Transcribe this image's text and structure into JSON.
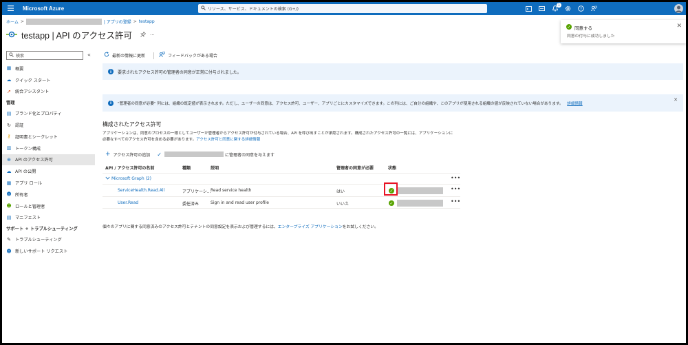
{
  "topbar": {
    "brand": "Microsoft Azure",
    "search_placeholder": "リソース、サービス、ドキュメントの検索 (G+/)",
    "notification_count": "1"
  },
  "breadcrumb": {
    "home": "ホーム",
    "sep": ">",
    "app_registrations": "| アプリの登録",
    "app": "testapp"
  },
  "page": {
    "title": "testapp | API のアクセス許可"
  },
  "sidebar": {
    "search_placeholder": "検索",
    "collapse": "«",
    "items_top": [
      {
        "label": "概要",
        "icon": "overview-icon",
        "glyph": "▦",
        "color": "#0f6cbd"
      },
      {
        "label": "クイック スタート",
        "icon": "quickstart-icon",
        "glyph": "☁",
        "color": "#0f6cbd"
      },
      {
        "label": "統合アシスタント",
        "icon": "rocket-icon",
        "glyph": "➚",
        "color": "#d83b01"
      }
    ],
    "manage_header": "管理",
    "items_manage": [
      {
        "label": "ブランド化とプロパティ",
        "icon": "branding-icon",
        "glyph": "▤",
        "color": "#0f6cbd"
      },
      {
        "label": "認証",
        "icon": "auth-icon",
        "glyph": "↻",
        "color": "#323130"
      },
      {
        "label": "証明書とシークレット",
        "icon": "key-icon",
        "glyph": "⚷",
        "color": "#e8a202"
      },
      {
        "label": "トークン構成",
        "icon": "token-icon",
        "glyph": "▥",
        "color": "#0f6cbd"
      },
      {
        "label": "API のアクセス許可",
        "icon": "api-permissions-icon",
        "glyph": "⊕",
        "color": "#0f6cbd",
        "active": true
      },
      {
        "label": "API の公開",
        "icon": "cloud-icon",
        "glyph": "☁",
        "color": "#0f6cbd"
      },
      {
        "label": "アプリ ロール",
        "icon": "app-roles-icon",
        "glyph": "▦",
        "color": "#0f6cbd"
      },
      {
        "label": "所有者",
        "icon": "owners-icon",
        "glyph": "☻",
        "color": "#0f6cbd"
      },
      {
        "label": "ロールと管理者",
        "icon": "roles-icon",
        "glyph": "☻",
        "color": "#57a300"
      },
      {
        "label": "マニフェスト",
        "icon": "manifest-icon",
        "glyph": "▤",
        "color": "#0f6cbd"
      }
    ],
    "support_header": "サポート + トラブルシューティング",
    "items_support": [
      {
        "label": "トラブルシューティング",
        "icon": "wrench-icon",
        "glyph": "✎",
        "color": "#323130"
      },
      {
        "label": "新しいサポート リクエスト",
        "icon": "support-icon",
        "glyph": "☻",
        "color": "#0f6cbd"
      }
    ]
  },
  "toolbar": {
    "refresh": "最新の情報に更新",
    "feedback": "フィードバックがある場合"
  },
  "banners": {
    "consent_success": "要求されたアクセス許可の管理者の同意が正常に付与されました。",
    "info": "\"管理者の同意が必要\" 列には、組織の既定値が表示されます。ただし、ユーザーの同意は、アクセス許可、ユーザー、アプリごとにカスタマイズできます。この列には、ご自分の組織や、このアプリが使用される組織の値が反映されていない場合があります。",
    "info_link": "詳細情報"
  },
  "configured": {
    "title": "構成されたアクセス許可",
    "desc_1": "アプリケーションは、同意のプロセスの一環としてユーザーか管理者からアクセス許可が付与されている場合、API を呼び出すことが承認されます。構成されたアクセス許可の一覧には、アプリケーションに",
    "desc_2": "必要なすべてのアクセス許可を含める必要があります。",
    "desc_link": "アクセス許可と同意に関する詳細情報",
    "add_permission": "アクセス許可の追加",
    "grant_consent_suffix": "に管理者の同意を与えます"
  },
  "table": {
    "headers": {
      "api": "API / アクセス許可の名前",
      "type": "種類",
      "desc": "説明",
      "admin": "管理者の同意が必要",
      "status": "状態"
    },
    "group": "Microsoft Graph (2)",
    "more": "•••",
    "rows": [
      {
        "name": "ServiceHealth.Read.All",
        "type": "アプリケーシ...",
        "desc": "Read service health",
        "admin": "はい"
      },
      {
        "name": "User.Read",
        "type": "委任済み",
        "desc": "Sign in and read user profile",
        "admin": "いいえ"
      }
    ]
  },
  "footer": {
    "text": "個々のアプリに関する同意済みのアクセス許可とテナントの同意設定を表示および管理するには、",
    "link": "エンタープライズ アプリケーション",
    "suffix": "をお試しください。"
  },
  "toast": {
    "title": "同意する",
    "message": "同意の付与に成功しました",
    "close": "✕"
  }
}
